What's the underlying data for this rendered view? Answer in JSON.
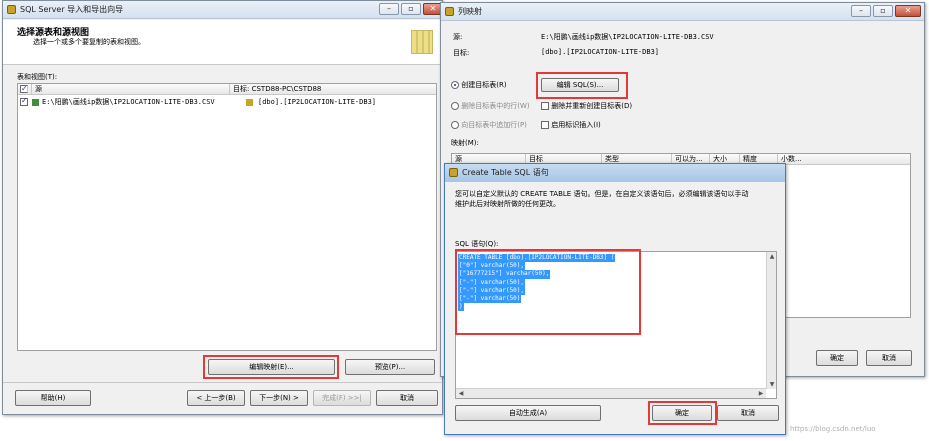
{
  "colors": {
    "highlight_box": "#e23a3a",
    "selection": "#3399ff",
    "title_active": "#a8c6e6"
  },
  "wizard": {
    "title": "SQL Server 导入和导出向导",
    "header_title": "选择源表和源视图",
    "header_subtitle": "选择一个或多个要复制的表和视图。",
    "tables_label": "表和视图(T):",
    "col_source": "源",
    "col_target": "目标: CSTD88-PC\\CSTD88",
    "row_source": "E:\\阳鹏\\画线ip数据\\IP2LOCATION-LITE-DB3.CSV",
    "row_target": "[dbo].[IP2LOCATION-LITE-DB3]",
    "edit_mapping_btn": "编辑映射(E)...",
    "preview_btn": "预览(P)...",
    "help_btn": "帮助(H)",
    "back_btn": "< 上一步(B)",
    "next_btn": "下一步(N) >",
    "finish_btn": "完成(F) >>|",
    "cancel_btn": "取消"
  },
  "mapping": {
    "title": "列映射",
    "source_label": "源:",
    "source_value": "E:\\阳鹏\\画线ip数据\\IP2LOCATION-LITE-DB3.CSV",
    "target_label": "目标:",
    "target_value": "[dbo].[IP2LOCATION-LITE-DB3]",
    "create_table": "创建目标表(R)",
    "edit_sql_btn": "编辑 SQL(S)...",
    "delete_rows": "删除目标表中的行(W)",
    "drop_recreate": "删除并重新创建目标表(D)",
    "append_rows": "向目标表中追加行(P)",
    "enable_identity": "启用标识插入(I)",
    "mapping_label": "映射(M):",
    "columns": [
      "源",
      "目标",
      "类型",
      "可以为...",
      "大小",
      "精度",
      "小数..."
    ],
    "ok_btn": "确定",
    "cancel_btn": "取消"
  },
  "sqldlg": {
    "title": "Create Table SQL 语句",
    "desc_line1": "您可以自定义默认的 CREATE TABLE 语句。但是，在自定义该语句后，必须编辑该语句以手动",
    "desc_line2": "维护此后对映射所做的任何更改。",
    "sql_label": "SQL 语句(Q):",
    "sql_lines": [
      "CREATE TABLE [dbo].[IP2LOCATION-LITE-DB3] (",
      "[\"0\"] varchar(50),",
      "[\"16777215\"] varchar(50),",
      "[\"-\"] varchar(50),",
      "[\"-\"] varchar(50),",
      "[\"-\"] varchar(50)",
      ")"
    ],
    "auto_generate_btn": "自动生成(A)",
    "ok_btn": "确定",
    "cancel_btn": "取消"
  },
  "watermark": "https://blog.csdn.net/luo"
}
